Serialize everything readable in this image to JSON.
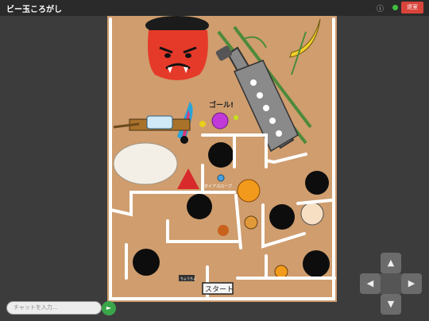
{
  "app": {
    "title": "ビー玉ころがし"
  },
  "header": {
    "info_icon": "info-icon",
    "exit_label": "退室",
    "online_color": "#3fbf3f",
    "exit_color": "#d9443a"
  },
  "board": {
    "goal_label": "ゴール!",
    "start_label": "スタート",
    "sign_label": "ちょうちょ",
    "player_label": "ダイアスロープ",
    "colors": {
      "background": "#cf9d6e",
      "wall": "#ffffff",
      "hole": "#0d0d0d",
      "oni": "#e53a2a"
    }
  },
  "chat": {
    "placeholder": "チャットを入力...",
    "send_color": "#3aa64a"
  },
  "dpad": {
    "up": "▲",
    "down": "▼",
    "left": "◀",
    "right": "▶"
  }
}
